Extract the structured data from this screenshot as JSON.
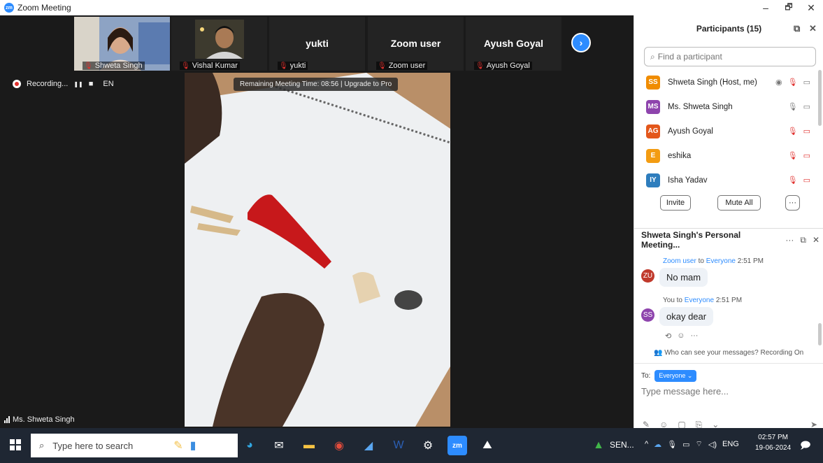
{
  "window": {
    "app_logo": "zm",
    "title": "Zoom Meeting",
    "controls": [
      "–",
      "🗗",
      "✕"
    ]
  },
  "thumbnails": [
    {
      "name": "Shweta Singh",
      "type": "video"
    },
    {
      "name": "Vishal Kumar",
      "type": "video"
    },
    {
      "name": "yukti",
      "big_name": "yukti",
      "type": "name"
    },
    {
      "name": "Zoom user",
      "big_name": "Zoom user",
      "type": "name"
    },
    {
      "name": "Ayush Goyal",
      "big_name": "Ayush Goyal",
      "type": "name"
    }
  ],
  "recording": {
    "label": "Recording...",
    "pause": "❚❚",
    "stop": "■",
    "lang": "EN"
  },
  "banner": "Remaining Meeting Time: 08:56 | Upgrade to Pro",
  "active_speaker": "Ms. Shweta Singh",
  "participants": {
    "title": "Participants (15)",
    "search_placeholder": "Find a participant",
    "list": [
      {
        "initials": "SS",
        "name": "Shweta Singh (Host, me)",
        "color": "#f08c00"
      },
      {
        "initials": "MS",
        "name": "Ms. Shweta Singh",
        "color": "#8e44ad"
      },
      {
        "initials": "AG",
        "name": "Ayush Goyal",
        "color": "#e3571b"
      },
      {
        "initials": "E",
        "name": "eshika",
        "color": "#f39c12"
      },
      {
        "initials": "IY",
        "name": "Isha Yadav",
        "color": "#2e7dbd"
      }
    ],
    "invite_label": "Invite",
    "mute_all_label": "Mute All",
    "more_label": "···"
  },
  "chat": {
    "title": "Shweta Singh's Personal Meeting...",
    "messages": [
      {
        "sender": "Zoom user",
        "to_word": "to",
        "to": "Everyone",
        "time": "2:51 PM",
        "text": "No mam",
        "initials": "ZU",
        "color": "#c0392b"
      },
      {
        "sender": "You",
        "to_word": "to",
        "to": "Everyone",
        "time": "2:51 PM",
        "text": "okay dear",
        "initials": "SS",
        "color": "#8e44ad"
      }
    ],
    "privacy_note": "Who can see your messages? Recording On",
    "to_label": "To:",
    "to_value": "Everyone ⌄",
    "input_placeholder": "Type message here..."
  },
  "taskbar": {
    "search_placeholder": "Type here to search",
    "stock_label": "SEN...",
    "lang": "ENG",
    "time": "02:57 PM",
    "date": "19-06-2024"
  }
}
